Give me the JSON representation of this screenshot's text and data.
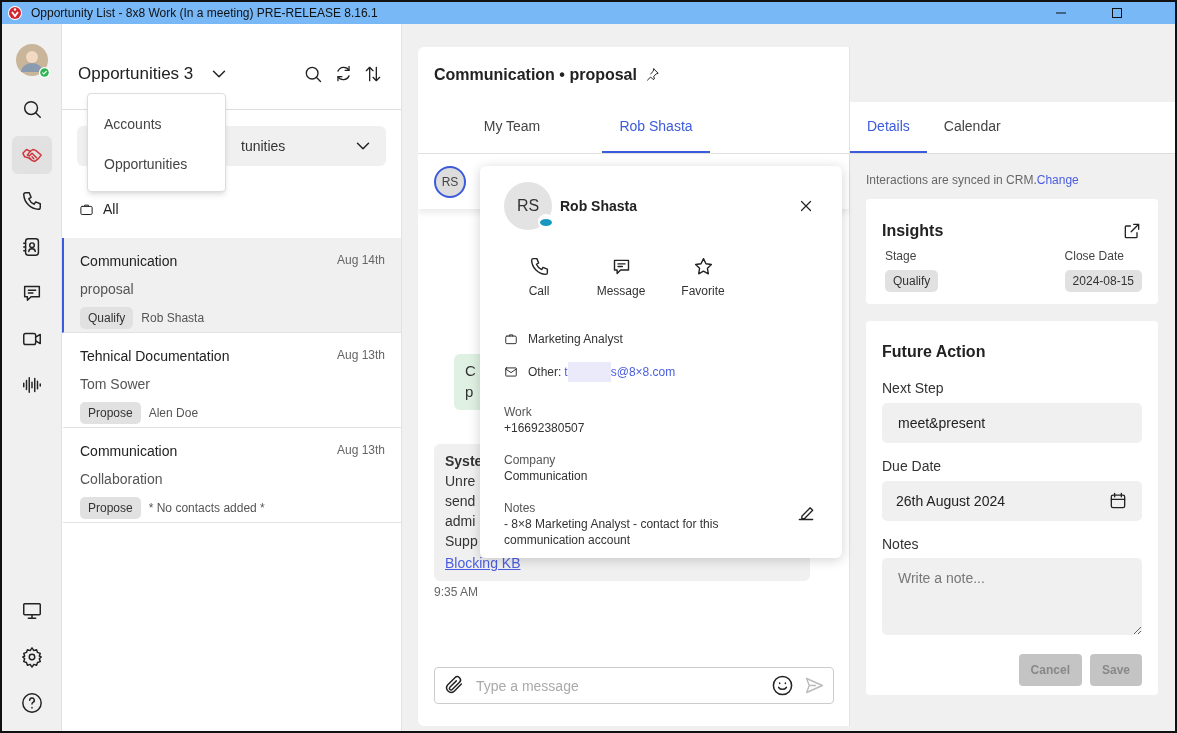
{
  "window": {
    "title": "Opportunity List - 8x8 Work (In a meeting) PRE-RELEASE 8.16.1"
  },
  "rail": {
    "items": [
      {
        "kind": "search",
        "selected": false
      },
      {
        "kind": "handshake",
        "selected": true
      },
      {
        "kind": "phone",
        "selected": false
      },
      {
        "kind": "contacts",
        "selected": false
      },
      {
        "kind": "chat",
        "selected": false
      },
      {
        "kind": "video",
        "selected": false
      },
      {
        "kind": "waveform",
        "selected": false
      }
    ],
    "bottom_items": [
      {
        "kind": "monitor"
      },
      {
        "kind": "settings"
      },
      {
        "kind": "help"
      }
    ]
  },
  "list_panel": {
    "title": "Opportunities 3",
    "menu": [
      {
        "label": "Accounts"
      },
      {
        "label": "Opportunities"
      }
    ],
    "filter": {
      "value": "tunities"
    },
    "scope": "All",
    "rows": [
      {
        "title": "Communication",
        "subtitle": "proposal",
        "date": "Aug 14th",
        "stage": "Qualify",
        "contact": "Rob Shasta",
        "selected": true
      },
      {
        "title": "Tehnical Documentation",
        "subtitle": "Tom Sower",
        "date": "Aug 13th",
        "stage": "Propose",
        "contact": "Alen Doe",
        "selected": false
      },
      {
        "title": "Communication",
        "subtitle": "Collaboration",
        "date": "Aug 13th",
        "stage": "Propose",
        "contact": "* No contacts added *",
        "selected": false
      }
    ]
  },
  "conversation": {
    "title": "Communication • proposal",
    "tabs": [
      {
        "label": "My Team",
        "selected": false
      },
      {
        "label": "Rob Shasta",
        "selected": true
      }
    ],
    "participant": {
      "initials": "RS"
    },
    "bubble_lines": [
      "C",
      "p"
    ],
    "system_message": {
      "lines": [
        "Syste",
        "Unre",
        "send",
        "admi",
        "Supp"
      ],
      "link": "Blocking KB",
      "time": "9:35 AM"
    },
    "composer": {
      "placeholder": "Type a message"
    }
  },
  "contact_card": {
    "initials": "RS",
    "name": "Rob Shasta",
    "actions": [
      {
        "kind": "call",
        "label": "Call"
      },
      {
        "kind": "message",
        "label": "Message"
      },
      {
        "kind": "favorite",
        "label": "Favorite"
      }
    ],
    "job_title": "Marketing Analyst",
    "email_label": "Other:",
    "email_parts": [
      "t",
      "s@8×8.com"
    ],
    "fields": [
      {
        "label": "Work",
        "value": "+16692380507"
      },
      {
        "label": "Company",
        "value": "Communication"
      },
      {
        "label": "Notes",
        "value": "- 8×8 Marketing Analyst - contact for this communication account",
        "editable": true
      }
    ]
  },
  "details": {
    "tabs": [
      {
        "label": "Details",
        "selected": true
      },
      {
        "label": "Calendar",
        "selected": false
      }
    ],
    "sync_note": "Interactions are synced in CRM.",
    "sync_link": "Change",
    "insights": {
      "title": "Insights",
      "stage_label": "Stage",
      "stage": "Qualify",
      "close_label": "Close Date",
      "close_date": "2024-08-15"
    },
    "future_action": {
      "title": "Future Action",
      "next_step_label": "Next Step",
      "next_step": "meet&present",
      "due_label": "Due Date",
      "due_date": "26th August 2024",
      "notes_label": "Notes",
      "notes_placeholder": "Write a note...",
      "buttons": [
        {
          "label": "Cancel",
          "disabled": true
        },
        {
          "label": "Save",
          "disabled": true
        }
      ]
    }
  }
}
